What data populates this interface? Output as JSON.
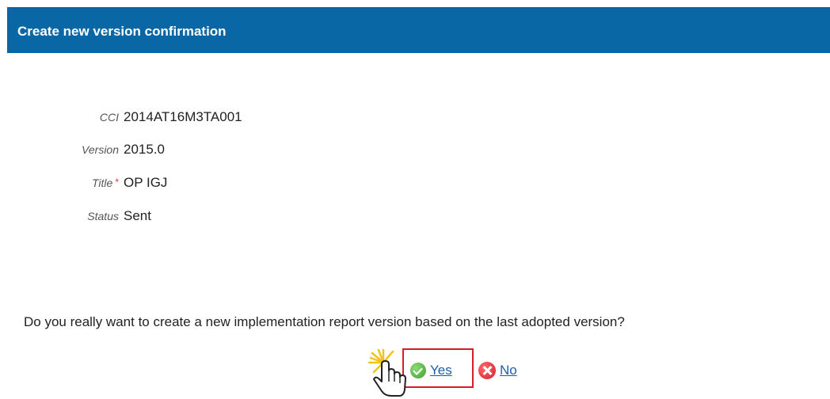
{
  "dialog": {
    "title": "Create new version confirmation"
  },
  "fields": [
    {
      "label": "CCI",
      "value": "2014AT16M3TA001",
      "required": false
    },
    {
      "label": "Version",
      "value": "2015.0",
      "required": false
    },
    {
      "label": "Title",
      "value": "OP IGJ",
      "required": true
    },
    {
      "label": "Status",
      "value": "Sent",
      "required": false
    }
  ],
  "required_marker": "*",
  "question": "Do you really want to create a new implementation report version based on the last adopted version?",
  "actions": {
    "yes_label": "Yes",
    "no_label": "No"
  },
  "icons": {
    "yes": "check-circle-icon",
    "no": "close-circle-icon",
    "cursor": "hand-pointer-icon"
  },
  "colors": {
    "header_bg": "#0a67a5",
    "highlight_border": "#d81e2c",
    "link": "#1a5fb4",
    "required": "#e0383c"
  }
}
